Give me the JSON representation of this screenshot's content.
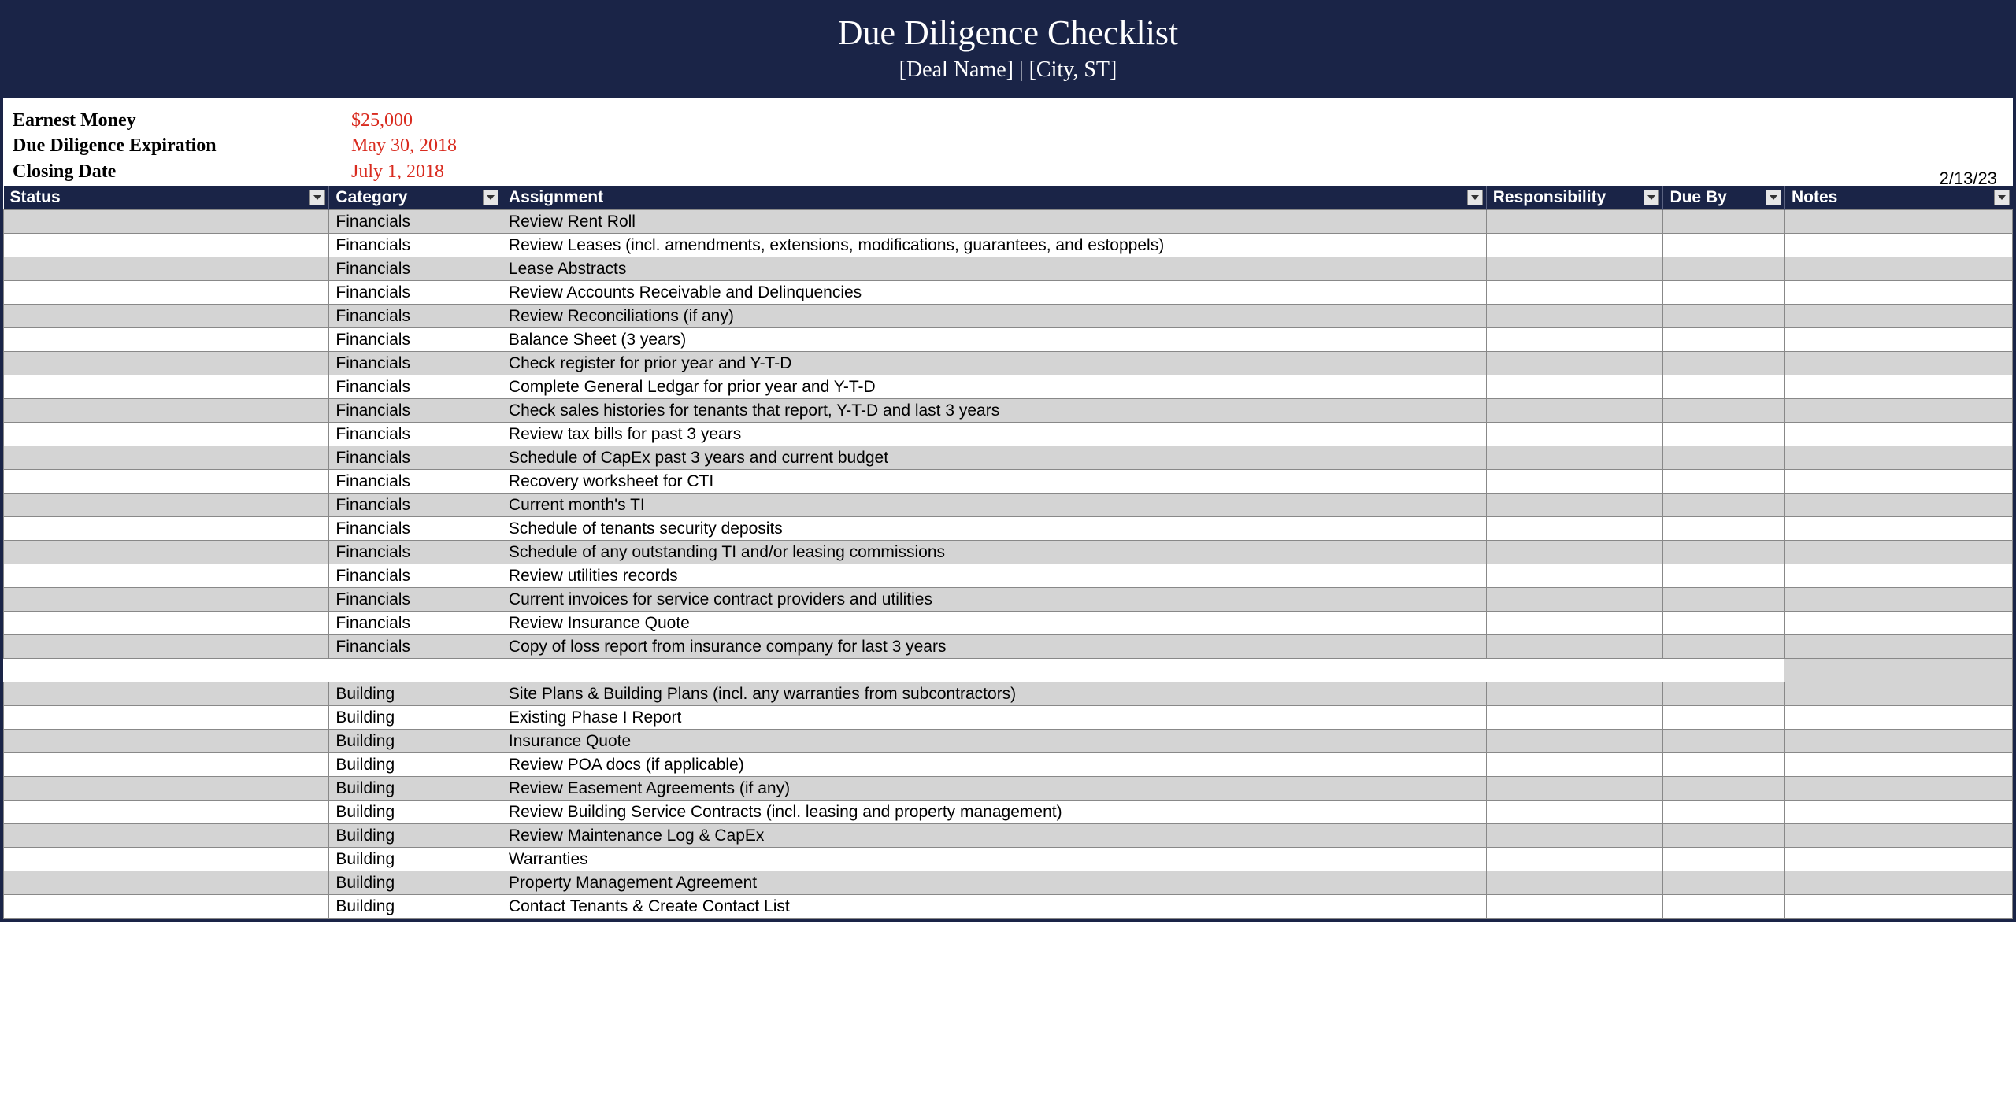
{
  "header": {
    "title": "Due Diligence Checklist",
    "subtitle": "[Deal Name]  |  [City, ST]"
  },
  "meta": {
    "earnest_label": "Earnest Money",
    "earnest_value": "$25,000",
    "dd_label": "Due Diligence Expiration",
    "dd_value": "May 30, 2018",
    "close_label": "Closing Date",
    "close_value": "July 1, 2018",
    "stamp": "2/13/23"
  },
  "columns": {
    "status": "Status",
    "category": "Category",
    "assignment": "Assignment",
    "responsibility": "Responsibility",
    "dueby": "Due By",
    "notes": "Notes"
  },
  "rows": [
    {
      "status": "",
      "category": "Financials",
      "assignment": "Review Rent Roll",
      "responsibility": "",
      "dueby": "",
      "notes": "",
      "alt": true
    },
    {
      "status": "",
      "category": "Financials",
      "assignment": "Review Leases (incl. amendments, extensions, modifications, guarantees, and estoppels)",
      "responsibility": "",
      "dueby": "",
      "notes": "",
      "alt": false
    },
    {
      "status": "",
      "category": "Financials",
      "assignment": "Lease Abstracts",
      "responsibility": "",
      "dueby": "",
      "notes": "",
      "alt": true
    },
    {
      "status": "",
      "category": "Financials",
      "assignment": "Review Accounts Receivable and Delinquencies",
      "responsibility": "",
      "dueby": "",
      "notes": "",
      "alt": false
    },
    {
      "status": "",
      "category": "Financials",
      "assignment": "Review Reconciliations (if any)",
      "responsibility": "",
      "dueby": "",
      "notes": "",
      "alt": true
    },
    {
      "status": "",
      "category": "Financials",
      "assignment": "Balance Sheet (3 years)",
      "responsibility": "",
      "dueby": "",
      "notes": "",
      "alt": false
    },
    {
      "status": "",
      "category": "Financials",
      "assignment": "Check register for prior year and Y-T-D",
      "responsibility": "",
      "dueby": "",
      "notes": "",
      "alt": true
    },
    {
      "status": "",
      "category": "Financials",
      "assignment": "Complete General Ledgar for prior year and Y-T-D",
      "responsibility": "",
      "dueby": "",
      "notes": "",
      "alt": false
    },
    {
      "status": "",
      "category": "Financials",
      "assignment": "Check sales histories for tenants that report, Y-T-D and last 3 years",
      "responsibility": "",
      "dueby": "",
      "notes": "",
      "alt": true
    },
    {
      "status": "",
      "category": "Financials",
      "assignment": "Review tax bills for past 3 years",
      "responsibility": "",
      "dueby": "",
      "notes": "",
      "alt": false
    },
    {
      "status": "",
      "category": "Financials",
      "assignment": "Schedule of CapEx past 3 years and current budget",
      "responsibility": "",
      "dueby": "",
      "notes": "",
      "alt": true
    },
    {
      "status": "",
      "category": "Financials",
      "assignment": "Recovery worksheet for CTI",
      "responsibility": "",
      "dueby": "",
      "notes": "",
      "alt": false
    },
    {
      "status": "",
      "category": "Financials",
      "assignment": "Current month's TI",
      "responsibility": "",
      "dueby": "",
      "notes": "",
      "alt": true
    },
    {
      "status": "",
      "category": "Financials",
      "assignment": "Schedule of tenants security deposits",
      "responsibility": "",
      "dueby": "",
      "notes": "",
      "alt": false
    },
    {
      "status": "",
      "category": "Financials",
      "assignment": "Schedule of any outstanding TI and/or leasing commissions",
      "responsibility": "",
      "dueby": "",
      "notes": "",
      "alt": true
    },
    {
      "status": "",
      "category": "Financials",
      "assignment": "Review utilities records",
      "responsibility": "",
      "dueby": "",
      "notes": "",
      "alt": false
    },
    {
      "status": "",
      "category": "Financials",
      "assignment": "Current invoices for service contract providers and utilities",
      "responsibility": "",
      "dueby": "",
      "notes": "",
      "alt": true
    },
    {
      "status": "",
      "category": "Financials",
      "assignment": "Review Insurance Quote",
      "responsibility": "",
      "dueby": "",
      "notes": "",
      "alt": false
    },
    {
      "status": "",
      "category": "Financials",
      "assignment": "Copy of loss report from insurance company for last 3 years",
      "responsibility": "",
      "dueby": "",
      "notes": "",
      "alt": true
    },
    {
      "blank": true
    },
    {
      "status": "",
      "category": "Building",
      "assignment": "Site Plans & Building Plans (incl. any warranties from subcontractors)",
      "responsibility": "",
      "dueby": "",
      "notes": "",
      "alt": true
    },
    {
      "status": "",
      "category": "Building",
      "assignment": "Existing Phase I Report",
      "responsibility": "",
      "dueby": "",
      "notes": "",
      "alt": false
    },
    {
      "status": "",
      "category": "Building",
      "assignment": "Insurance Quote",
      "responsibility": "",
      "dueby": "",
      "notes": "",
      "alt": true
    },
    {
      "status": "",
      "category": "Building",
      "assignment": "Review POA docs (if applicable)",
      "responsibility": "",
      "dueby": "",
      "notes": "",
      "alt": false
    },
    {
      "status": "",
      "category": "Building",
      "assignment": "Review Easement Agreements (if any)",
      "responsibility": "",
      "dueby": "",
      "notes": "",
      "alt": true
    },
    {
      "status": "",
      "category": "Building",
      "assignment": "Review Building Service Contracts (incl. leasing and property management)",
      "responsibility": "",
      "dueby": "",
      "notes": "",
      "alt": false
    },
    {
      "status": "",
      "category": "Building",
      "assignment": "Review Maintenance Log & CapEx",
      "responsibility": "",
      "dueby": "",
      "notes": "",
      "alt": true
    },
    {
      "status": "",
      "category": "Building",
      "assignment": "Warranties",
      "responsibility": "",
      "dueby": "",
      "notes": "",
      "alt": false
    },
    {
      "status": "",
      "category": "Building",
      "assignment": "Property Management Agreement",
      "responsibility": "",
      "dueby": "",
      "notes": "",
      "alt": true
    },
    {
      "status": "",
      "category": "Building",
      "assignment": "Contact Tenants & Create Contact List",
      "responsibility": "",
      "dueby": "",
      "notes": "",
      "alt": false
    }
  ]
}
